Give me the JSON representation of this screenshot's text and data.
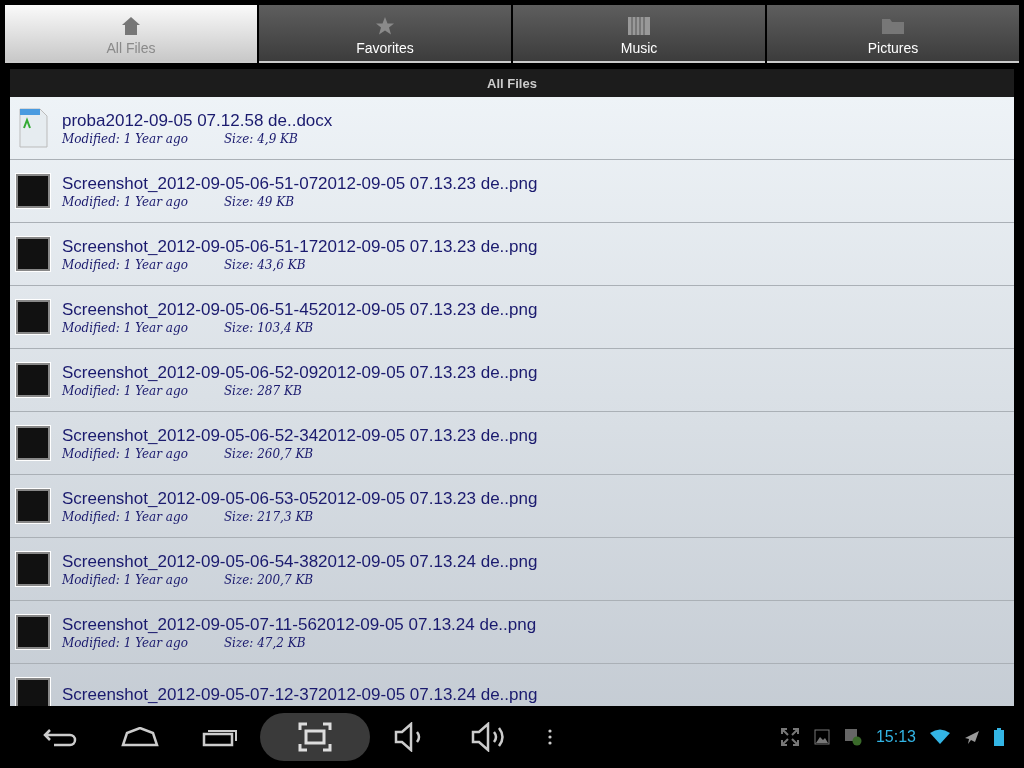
{
  "tabs": [
    {
      "label": "All Files",
      "kind": "home",
      "selected": true
    },
    {
      "label": "Favorites",
      "kind": "star",
      "selected": false
    },
    {
      "label": "Music",
      "kind": "music",
      "selected": false
    },
    {
      "label": "Pictures",
      "kind": "folder",
      "selected": false
    }
  ],
  "list_header": "All Files",
  "files": [
    {
      "kind": "document",
      "name": "proba2012-09-05 07.12.58 de..docx",
      "modified": "Modified: 1 Year ago",
      "size": "Size: 4,9 KB"
    },
    {
      "kind": "image",
      "name": "Screenshot_2012-09-05-06-51-072012-09-05 07.13.23 de..png",
      "modified": "Modified: 1 Year ago",
      "size": "Size: 49 KB"
    },
    {
      "kind": "image",
      "name": "Screenshot_2012-09-05-06-51-172012-09-05 07.13.23 de..png",
      "modified": "Modified: 1 Year ago",
      "size": "Size: 43,6 KB"
    },
    {
      "kind": "image",
      "name": "Screenshot_2012-09-05-06-51-452012-09-05 07.13.23 de..png",
      "modified": "Modified: 1 Year ago",
      "size": "Size: 103,4 KB"
    },
    {
      "kind": "image",
      "name": "Screenshot_2012-09-05-06-52-092012-09-05 07.13.23 de..png",
      "modified": "Modified: 1 Year ago",
      "size": "Size: 287 KB"
    },
    {
      "kind": "image",
      "name": "Screenshot_2012-09-05-06-52-342012-09-05 07.13.23 de..png",
      "modified": "Modified: 1 Year ago",
      "size": "Size: 260,7 KB"
    },
    {
      "kind": "image",
      "name": "Screenshot_2012-09-05-06-53-052012-09-05 07.13.23 de..png",
      "modified": "Modified: 1 Year ago",
      "size": "Size: 217,3 KB"
    },
    {
      "kind": "image",
      "name": "Screenshot_2012-09-05-06-54-382012-09-05 07.13.24 de..png",
      "modified": "Modified: 1 Year ago",
      "size": "Size: 200,7 KB"
    },
    {
      "kind": "image",
      "name": "Screenshot_2012-09-05-07-11-562012-09-05 07.13.24 de..png",
      "modified": "Modified: 1 Year ago",
      "size": "Size: 47,2 KB"
    },
    {
      "kind": "image",
      "name": "Screenshot_2012-09-05-07-12-372012-09-05 07.13.24 de..png"
    }
  ],
  "status_bar": {
    "time": "15:13"
  }
}
